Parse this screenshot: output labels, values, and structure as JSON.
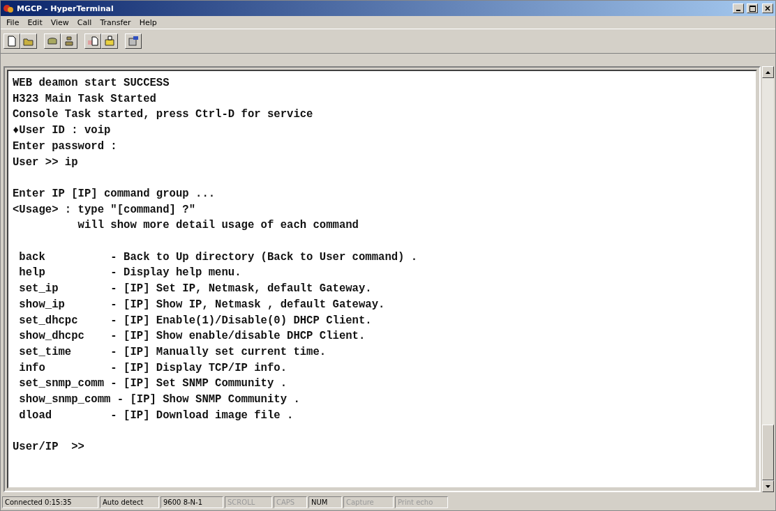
{
  "window": {
    "title": "MGCP - HyperTerminal"
  },
  "menu": [
    "File",
    "Edit",
    "View",
    "Call",
    "Transfer",
    "Help"
  ],
  "terminal": {
    "blocks": [
      [
        "WEB deamon start SUCCESS",
        "H323 Main Task Started",
        "Console Task started, press Ctrl-D for service",
        "♦User ID : voip",
        "Enter password :",
        "User >> ip"
      ],
      [
        "Enter IP [IP] command group ...",
        "<Usage> : type \"[command] ?\"",
        "          will show more detail usage of each command"
      ],
      [
        " back          - Back to Up directory (Back to User command) .",
        " help          - Display help menu.",
        " set_ip        - [IP] Set IP, Netmask, default Gateway.",
        " show_ip       - [IP] Show IP, Netmask , default Gateway.",
        " set_dhcpc     - [IP] Enable(1)/Disable(0) DHCP Client.",
        " show_dhcpc    - [IP] Show enable/disable DHCP Client.",
        " set_time      - [IP] Manually set current time.",
        " info          - [IP] Display TCP/IP info.",
        " set_snmp_comm - [IP] Set SNMP Community .",
        " show_snmp_comm - [IP] Show SNMP Community .",
        " dload         - [IP] Download image file ."
      ],
      [
        "User/IP  >>"
      ]
    ]
  },
  "status_bar": [
    {
      "text": "Connected 0:15:35",
      "active": true
    },
    {
      "text": "Auto detect",
      "active": true
    },
    {
      "text": "9600 8-N-1",
      "active": true
    },
    {
      "text": "SCROLL",
      "active": false
    },
    {
      "text": "CAPS",
      "active": false
    },
    {
      "text": "NUM",
      "active": true
    },
    {
      "text": "Capture",
      "active": false
    },
    {
      "text": "Print echo",
      "active": false
    }
  ]
}
